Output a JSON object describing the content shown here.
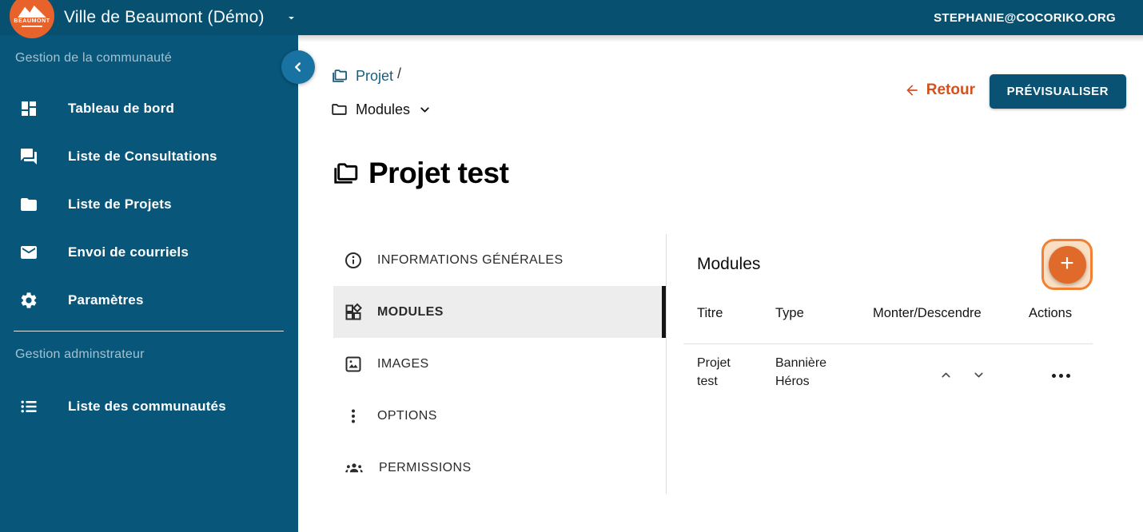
{
  "colors": {
    "topbar_bg": "#07506F",
    "sidebar_bg": "#08577A",
    "collapse_btn_bg": "#1873A3",
    "accent_orange": "#D4511E",
    "plus_circle_orange": "#E06A29",
    "plus_border_orange": "#F08033",
    "preview_button_bg": "#0A5273",
    "breadcrumb_link_teal": "#175E80",
    "selected_tab_bg": "#EDEDED"
  },
  "topbar": {
    "logo_text": "BEAUMONT",
    "community_name": "Ville de Beaumont (Démo)",
    "user_email": "STEPHANIE@COCORIKO.ORG"
  },
  "sidebar": {
    "section1_label": "Gestion de la communauté",
    "items1": [
      {
        "label": "Tableau de bord"
      },
      {
        "label": "Liste de Consultations"
      },
      {
        "label": "Liste de Projets"
      },
      {
        "label": "Envoi de courriels"
      },
      {
        "label": "Paramètres"
      }
    ],
    "section2_label": "Gestion adminstrateur",
    "items2": [
      {
        "label": "Liste des communautés"
      }
    ]
  },
  "breadcrumb": {
    "level1": "Projet",
    "separator": "/",
    "level2": "Modules"
  },
  "header_actions": {
    "back_label": "Retour",
    "preview_label": "PRÉVISUALISER"
  },
  "page": {
    "title": "Projet test"
  },
  "tabs": [
    {
      "label": "INFORMATIONS GÉNÉRALES"
    },
    {
      "label": "MODULES"
    },
    {
      "label": "IMAGES"
    },
    {
      "label": "OPTIONS"
    },
    {
      "label": "PERMISSIONS"
    }
  ],
  "modules_panel": {
    "heading": "Modules",
    "add_label": "+",
    "table": {
      "columns": [
        "Titre",
        "Type",
        "Monter/Descendre",
        "Actions"
      ],
      "rows": [
        {
          "titre": "Projet test",
          "type": "Bannière Héros"
        }
      ]
    }
  }
}
